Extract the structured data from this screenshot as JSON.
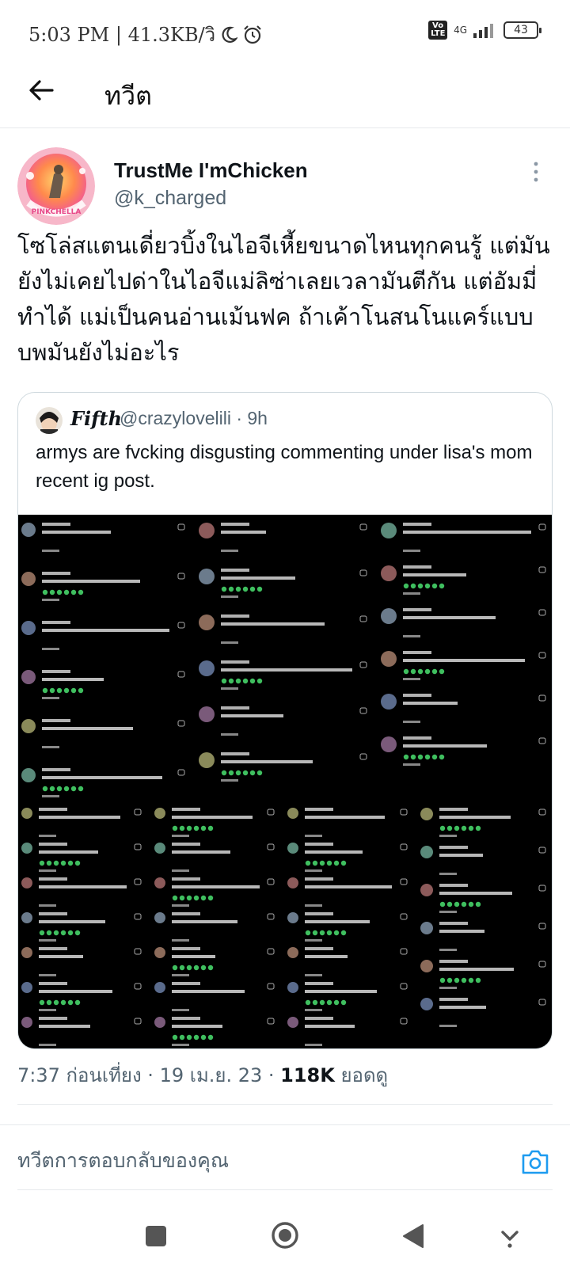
{
  "status_bar": {
    "time_and_speed": "5:03 PM | 41.3KB/วิ",
    "volte": "Vo LTE",
    "network": "4G",
    "battery": "43"
  },
  "header": {
    "title": "ทวีต"
  },
  "tweet": {
    "author_name": "TrustMe I'mChicken",
    "author_handle": "@k_charged",
    "avatar_text": "PINKCHELLA",
    "text": "โซโล่สแตนเดี่ยวบิ้งในไอจีเหี้ยขนาดไหนทุกคนรู้ แต่มันยังไม่เคยไปด่าในไอจีแม่ลิซ่าเลยเวลามันตีกัน แต่อัมมี่ทำได้ แม่เป็นคนอ่านเม้นฟค ถ้าเค้าโนสนโนแคร์แบบบพมันยังไม่อะไร"
  },
  "quote": {
    "author_name": "Fifth",
    "author_handle": "@crazylovelili · 9h",
    "text": "armys are fvcking disgusting commenting under lisa's mom recent ig post."
  },
  "meta": {
    "time_date": "7:37 ก่อนเที่ยง · 19 เม.ย. 23 · ",
    "views_count": "118K",
    "views_label": " ยอดดู"
  },
  "reply": {
    "placeholder": "ทวีตการตอบกลับของคุณ"
  },
  "colors": {
    "accent": "#1d9bf0",
    "text": "#0f1419",
    "muted": "#536471"
  }
}
